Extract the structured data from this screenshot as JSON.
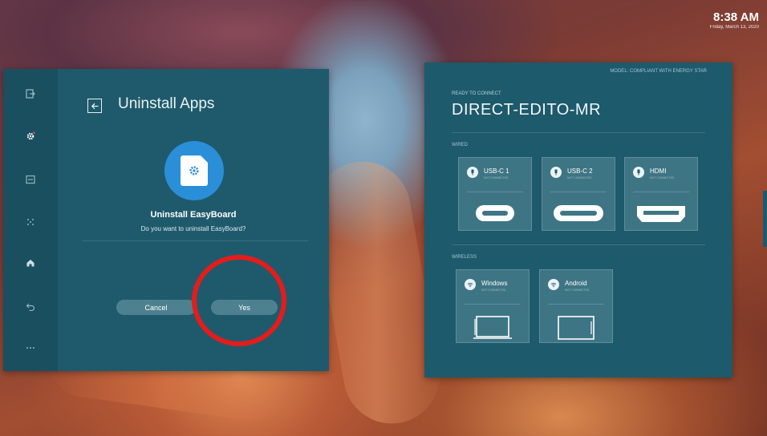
{
  "clock": {
    "time": "8:38 AM",
    "date": "Friday, March 13, 2020"
  },
  "settings": {
    "rail_icons": [
      "exit-icon",
      "settings-icon",
      "display-icon",
      "network-icon",
      "home-icon",
      "return-icon",
      "more-icon"
    ],
    "page_title": "Uninstall Apps",
    "dialog": {
      "title": "Uninstall EasyBoard",
      "message": "Do you want to uninstall EasyBoard?",
      "cancel_label": "Cancel",
      "yes_label": "Yes"
    }
  },
  "connect": {
    "model_note": "MODEL: COMPLIANT WITH ENERGY STAR",
    "ready_label": "READY TO CONNECT",
    "device_name": "DIRECT-EDITO-MR",
    "wired_label": "WIRED",
    "wireless_label": "WIRELESS",
    "wired": [
      {
        "name": "USB-C 1",
        "status": "NOT CONNECTED"
      },
      {
        "name": "USB-C 2",
        "status": "NOT CONNECTED"
      },
      {
        "name": "HDMI",
        "status": "NOT CONNECTED"
      }
    ],
    "wireless": [
      {
        "name": "Windows",
        "status": "NOT CONNECTED"
      },
      {
        "name": "Android",
        "status": "NOT CONNECTED"
      }
    ]
  },
  "colors": {
    "panel": "#1f5a6c",
    "rail": "#1a4f60",
    "card": "#3e7584",
    "button": "#4e8190",
    "annotation": "#e41c1c",
    "app_icon": "#2a8fd8"
  }
}
